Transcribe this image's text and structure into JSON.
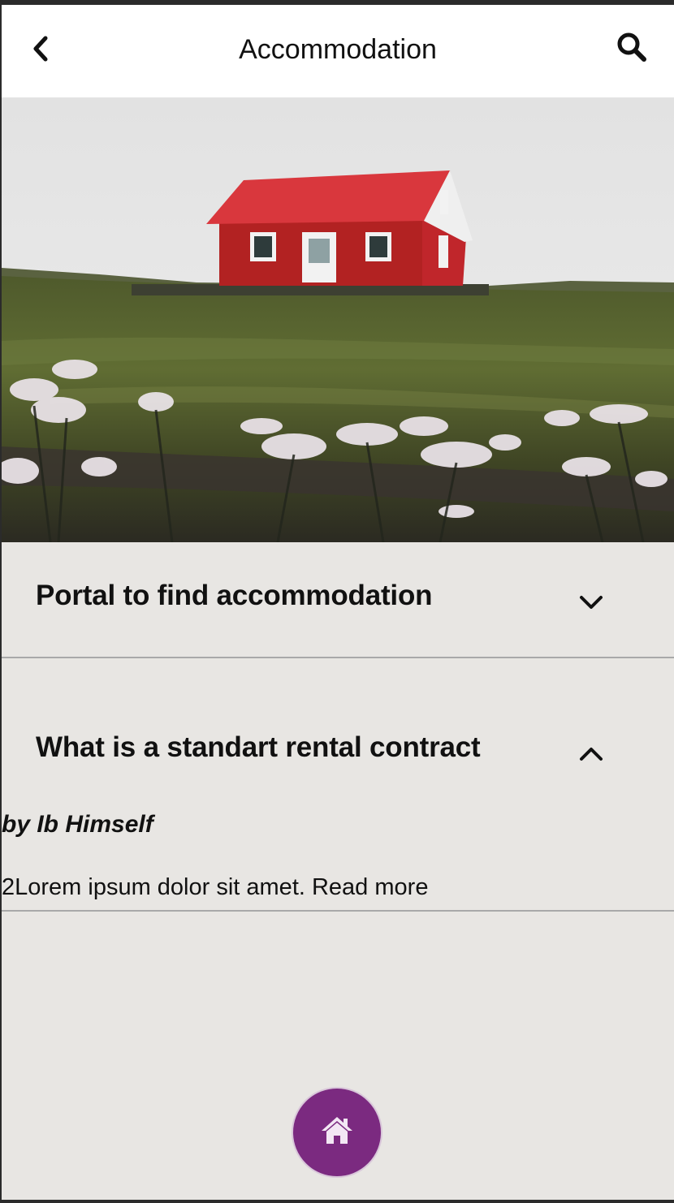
{
  "header": {
    "title": "Accommodation",
    "back_icon": "chevron-left-icon",
    "search_icon": "search-icon"
  },
  "hero": {
    "image": "red-house-on-hill-photo"
  },
  "accordion": {
    "items": [
      {
        "title": "Portal to find accommodation",
        "expanded": false,
        "icon": "chevron-down-icon"
      },
      {
        "title": "What is a standart rental contract",
        "expanded": true,
        "icon": "chevron-up-icon",
        "author": "by Ib Himself",
        "body": "2Lorem ipsum dolor sit amet. Read more"
      }
    ]
  },
  "fab": {
    "icon": "home-icon",
    "color": "#7b2a80"
  }
}
